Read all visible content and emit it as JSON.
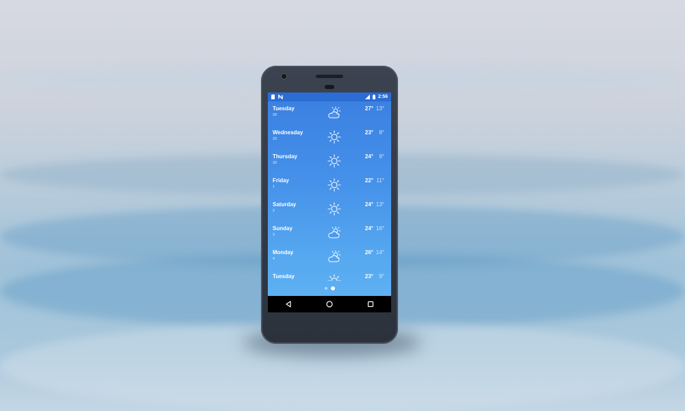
{
  "status_bar": {
    "time": "2:56",
    "left_icons": [
      "sd-card-icon",
      "notification-n-icon"
    ],
    "right_icons": [
      "signal-icon",
      "battery-icon"
    ]
  },
  "forecast": [
    {
      "day": "Tuesday",
      "date": "28",
      "icon": "partly-cloudy-icon",
      "high": "27°",
      "low": "13°"
    },
    {
      "day": "Wednesday",
      "date": "29",
      "icon": "sun-icon",
      "high": "23°",
      "low": "8°"
    },
    {
      "day": "Thursday",
      "date": "30",
      "icon": "sun-icon",
      "high": "24°",
      "low": "9°"
    },
    {
      "day": "Friday",
      "date": "1",
      "icon": "sun-icon",
      "high": "22°",
      "low": "11°"
    },
    {
      "day": "Saturday",
      "date": "2",
      "icon": "sun-icon",
      "high": "24°",
      "low": "13°"
    },
    {
      "day": "Sunday",
      "date": "3",
      "icon": "partly-cloudy-icon",
      "high": "24°",
      "low": "16°"
    },
    {
      "day": "Monday",
      "date": "4",
      "icon": "partly-cloudy-icon",
      "high": "26°",
      "low": "14°"
    },
    {
      "day": "Tuesday",
      "date": "",
      "icon": "sun-icon",
      "high": "23°",
      "low": "9°"
    }
  ],
  "pager": {
    "count": 2,
    "active": 2
  },
  "nav": [
    "back-icon",
    "home-icon",
    "recents-icon"
  ]
}
